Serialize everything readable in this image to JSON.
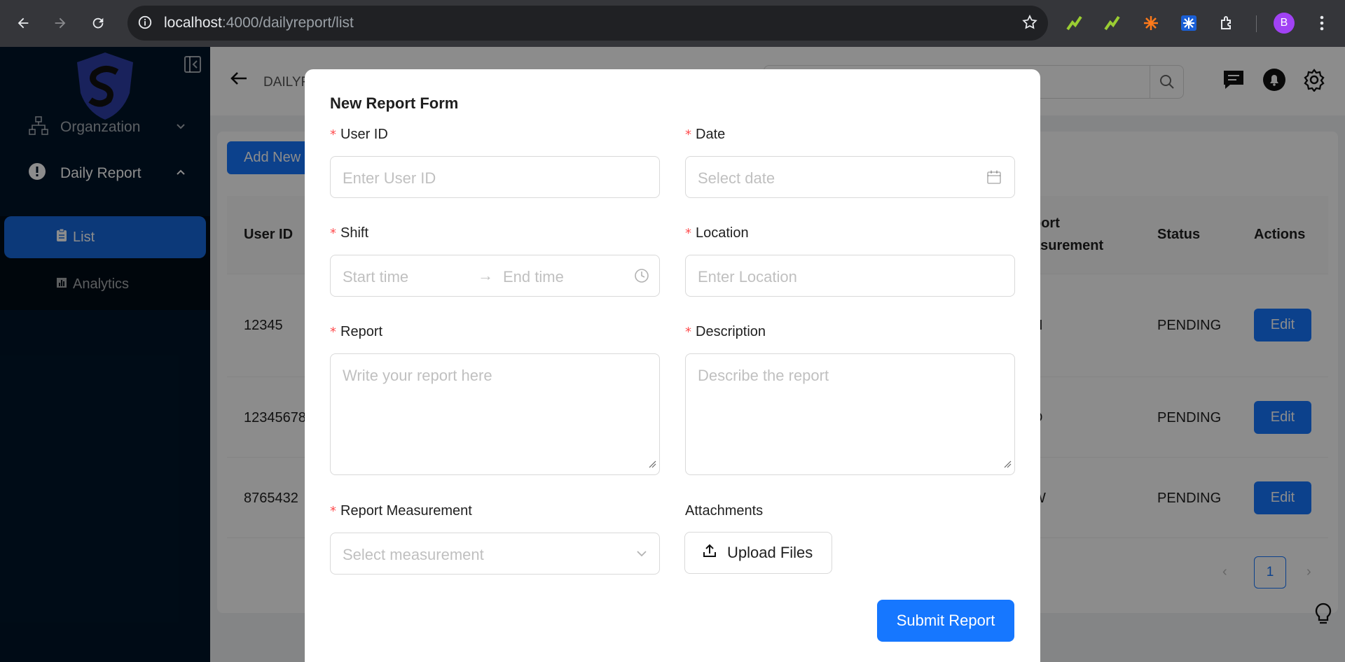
{
  "browser": {
    "url_host": "localhost",
    "url_path": ":4000/dailyreport/list",
    "profile_initial": "B"
  },
  "sidebar": {
    "items": [
      {
        "label": "Organzation",
        "icon": "sitemap-icon"
      },
      {
        "label": "Daily Report",
        "icon": "exclamation-circle-icon"
      }
    ],
    "subitems": [
      {
        "label": "List",
        "icon": "clipboard-icon"
      },
      {
        "label": "Analytics",
        "icon": "bar-chart-icon"
      }
    ]
  },
  "header": {
    "breadcrumb": "DAILYREPORT"
  },
  "table": {
    "add_button": "Add New",
    "columns": [
      "User ID",
      "port",
      "asurement",
      "Status",
      "Actions"
    ],
    "rows": [
      {
        "user_id": "12345",
        "measurement": "H",
        "status": "PENDING",
        "action": "Edit"
      },
      {
        "user_id": "12345678",
        "measurement": "D",
        "status": "PENDING",
        "action": "Edit"
      },
      {
        "user_id": "8765432",
        "measurement": "W",
        "status": "PENDING",
        "action": "Edit"
      }
    ],
    "current_page": "1"
  },
  "modal": {
    "title": "New Report Form",
    "user_id": {
      "label": "User ID",
      "placeholder": "Enter User ID"
    },
    "date": {
      "label": "Date",
      "placeholder": "Select date"
    },
    "shift": {
      "label": "Shift",
      "start_placeholder": "Start time",
      "end_placeholder": "End time"
    },
    "location": {
      "label": "Location",
      "placeholder": "Enter Location"
    },
    "report": {
      "label": "Report",
      "placeholder": "Write your report here"
    },
    "description": {
      "label": "Description",
      "placeholder": "Describe the report"
    },
    "measurement": {
      "label": "Report Measurement",
      "placeholder": "Select measurement"
    },
    "attachments": {
      "label": "Attachments",
      "button": "Upload Files"
    },
    "submit": "Submit Report"
  },
  "colors": {
    "primary": "#1677ff",
    "sidebar_bg": "#001529",
    "required": "#ff4d4f"
  }
}
